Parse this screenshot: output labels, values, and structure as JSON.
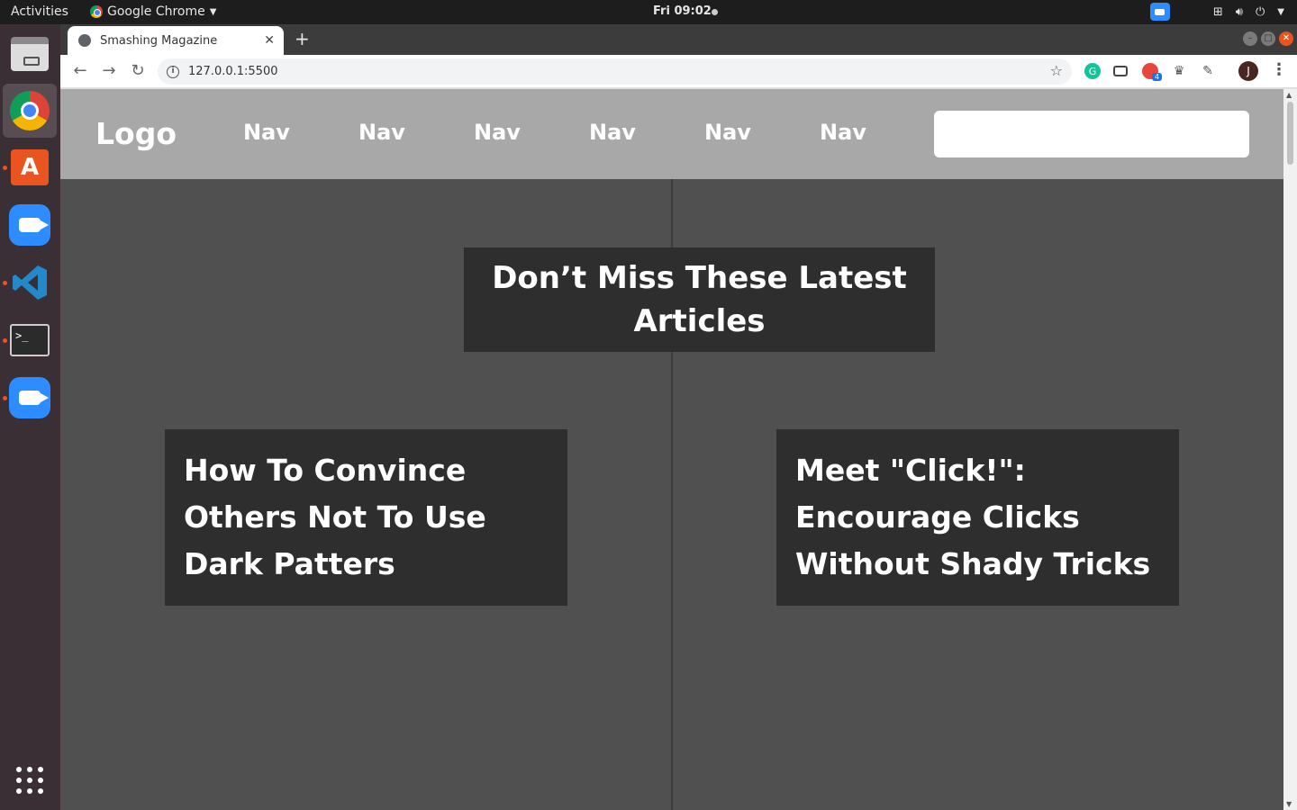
{
  "system_bar": {
    "activities": "Activities",
    "app_name": "Google Chrome",
    "clock": "Fri 09:02"
  },
  "dock": {
    "items": [
      "files",
      "google-chrome",
      "ubuntu-software",
      "zoom",
      "visual-studio-code",
      "terminal",
      "zoom"
    ],
    "show_apps": "show-applications"
  },
  "browser": {
    "tab_title": "Smashing Magazine",
    "url": "127.0.0.1:5500",
    "avatar_initial": "J",
    "extension_badge": "4"
  },
  "page": {
    "logo": "Logo",
    "nav_items": [
      "Nav",
      "Nav",
      "Nav",
      "Nav",
      "Nav",
      "Nav"
    ],
    "search": {
      "value": "",
      "placeholder": ""
    },
    "headline": "Don’t Miss These Latest Articles",
    "articles": [
      {
        "title": "How To Convince Others Not To Use Dark Patters"
      },
      {
        "title": "Meet \"Click!\": Encourage Clicks Without Shady Tricks"
      }
    ]
  },
  "colors": {
    "header_bg": "#a8a8a8",
    "page_bg": "#505050",
    "card_bg": "#2e2e2e",
    "text": "#ffffff",
    "accent": "#e95420"
  }
}
